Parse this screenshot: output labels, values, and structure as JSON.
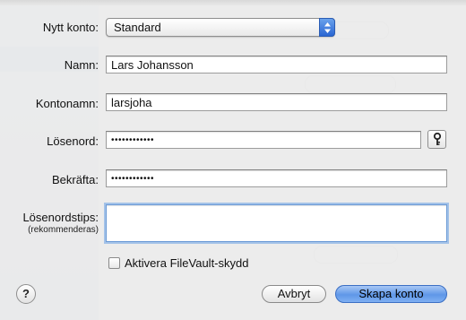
{
  "form": {
    "account_type_label": "Nytt konto:",
    "account_type_value": "Standard",
    "name_label": "Namn:",
    "name_value": "Lars Johansson",
    "account_name_label": "Kontonamn:",
    "account_name_value": "larsjoha",
    "password_label": "Lösenord:",
    "password_value": "••••••••••••",
    "verify_label": "Bekräfta:",
    "verify_value": "••••••••••••",
    "hint_label": "Lösenordstips:",
    "hint_sublabel": "(rekommenderas)",
    "hint_value": "",
    "filevault_label": "Aktivera FileVault-skydd",
    "filevault_checked": false
  },
  "buttons": {
    "help": "?",
    "cancel": "Avbryt",
    "create": "Skapa konto"
  },
  "icons": {
    "popup_arrows": "updown-arrows-icon",
    "password_assistant": "key-icon",
    "help": "question-mark-icon"
  },
  "colors": {
    "accent": "#5f97e8",
    "focus_ring": "#68a0e6"
  }
}
